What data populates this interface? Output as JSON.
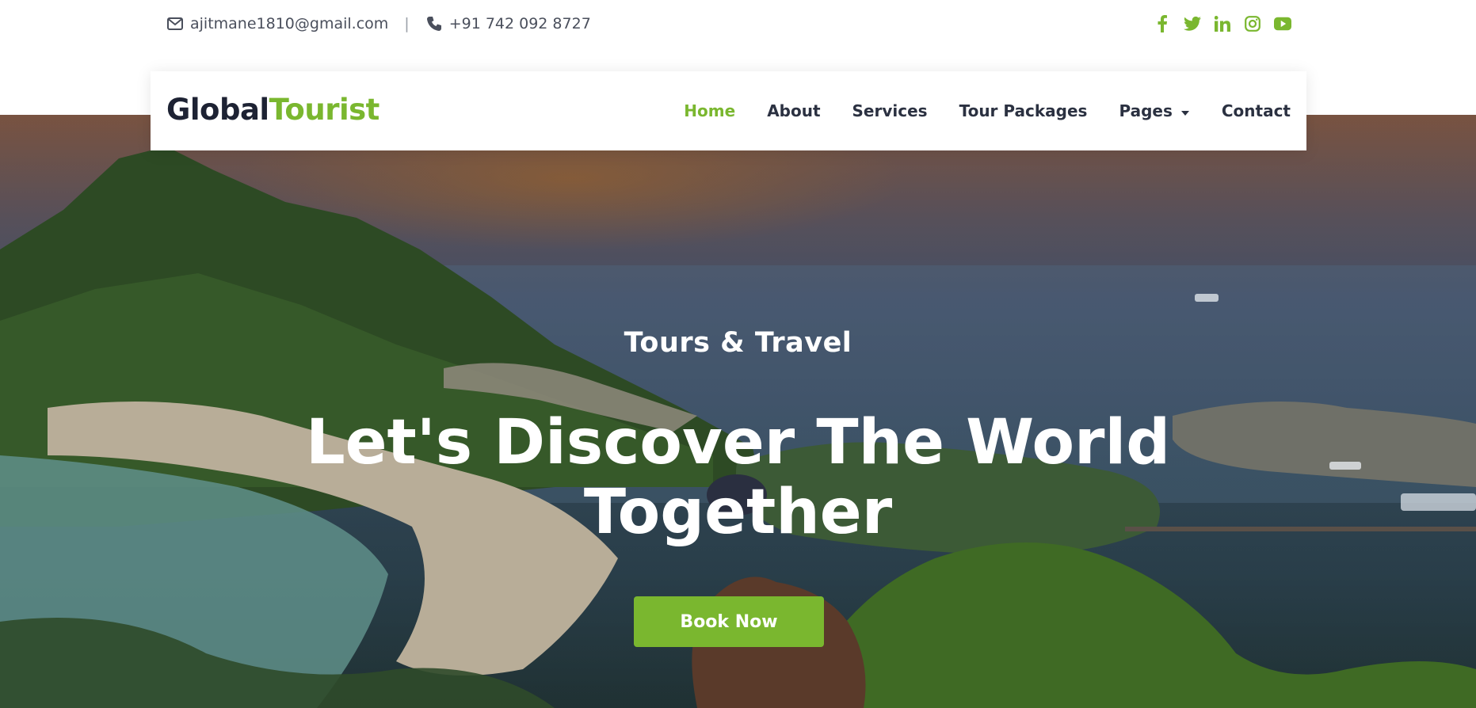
{
  "topbar": {
    "email": "ajitmane1810@gmail.com",
    "separator": "|",
    "phone": "+91 742 092 8727",
    "socials": [
      "facebook-icon",
      "twitter-icon",
      "linkedin-icon",
      "instagram-icon",
      "youtube-icon"
    ]
  },
  "brand": {
    "part1": "Global",
    "part2": "Tourist"
  },
  "nav": {
    "items": [
      {
        "label": "Home",
        "active": true
      },
      {
        "label": "About"
      },
      {
        "label": "Services"
      },
      {
        "label": "Tour Packages"
      },
      {
        "label": "Pages",
        "has_dropdown": true
      },
      {
        "label": "Contact"
      }
    ]
  },
  "hero": {
    "eyebrow": "Tours & Travel",
    "headline_line1": "Let's Discover The World",
    "headline_line2": "Together",
    "cta_label": "Book Now"
  },
  "colors": {
    "accent": "#7ab72f",
    "dark": "#1d2233",
    "text": "#4a4f5c"
  }
}
